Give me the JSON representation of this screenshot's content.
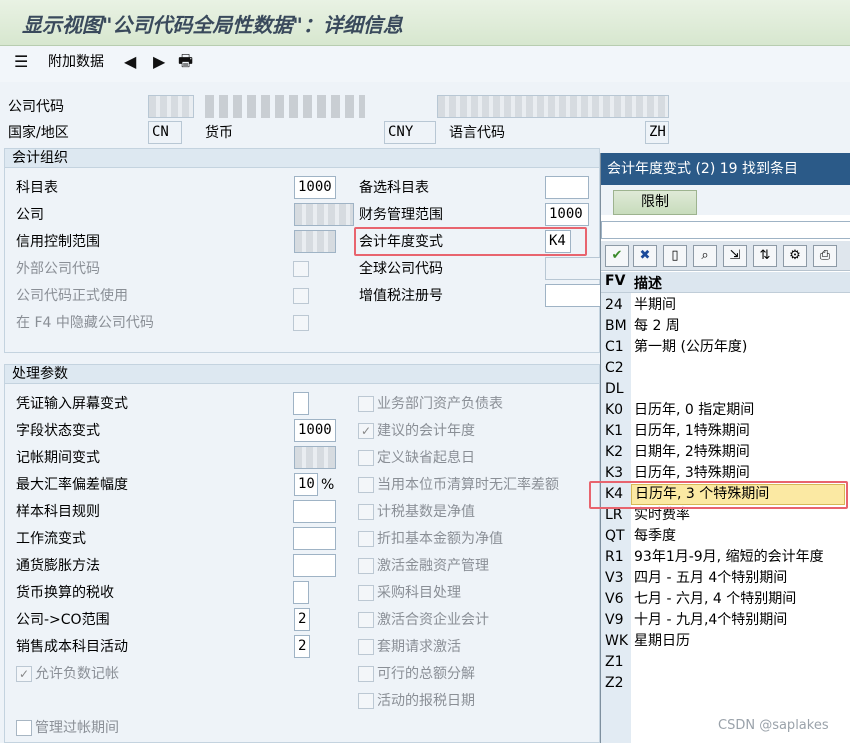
{
  "window": {
    "title": "显示视图\"公司代码全局性数据\"：详细信息"
  },
  "toolbar": {
    "additional_data": "附加数据"
  },
  "header": {
    "company_code_label": "公司代码",
    "country_label": "国家/地区",
    "country_value": "CN",
    "currency_label": "货币",
    "currency_value": "CNY",
    "language_label": "语言代码",
    "language_value": "ZH"
  },
  "accounting_org": {
    "title": "会计组织",
    "chart_of_accounts_label": "科目表",
    "chart_of_accounts_value": "1000",
    "company_label": "公司",
    "credit_control_label": "信用控制范围",
    "external_company_code_label": "外部公司代码",
    "company_code_productive_label": "公司代码正式使用",
    "hide_company_code_f4_label": "在 F4 中隐藏公司代码",
    "alt_chart_label": "备选科目表",
    "fm_area_label": "财务管理范围",
    "fm_area_value": "1000",
    "fiscal_year_variant_label": "会计年度变式",
    "fiscal_year_variant_value": "K4",
    "global_company_code_label": "全球公司代码",
    "vat_registration_label": "增值税注册号"
  },
  "processing": {
    "title": "处理参数",
    "left": [
      {
        "label": "凭证输入屏幕变式",
        "value": ""
      },
      {
        "label": "字段状态变式",
        "value": "1000"
      },
      {
        "label": "记帐期间变式",
        "value": ""
      },
      {
        "label": "最大汇率偏差幅度",
        "value": "10",
        "unit": "%"
      },
      {
        "label": "样本科目规则",
        "value": ""
      },
      {
        "label": "工作流变式",
        "value": ""
      },
      {
        "label": "通货膨胀方法",
        "value": ""
      },
      {
        "label": "货币换算的税收",
        "value": ""
      },
      {
        "label": "公司->CO范围",
        "value": "2"
      },
      {
        "label": "销售成本科目活动",
        "value": "2"
      }
    ],
    "allow_negative_postings": "允许负数记帐",
    "manage_posting_periods": "管理过帐期间",
    "right": [
      {
        "label": "业务部门资产负债表",
        "checked": ""
      },
      {
        "label": "建议的会计年度",
        "checked": "✓"
      },
      {
        "label": "定义缺省起息日",
        "checked": ""
      },
      {
        "label": "当用本位币清算时无汇率差额",
        "checked": ""
      },
      {
        "label": "计税基数是净值",
        "checked": ""
      },
      {
        "label": "折扣基本金额为净值",
        "checked": ""
      },
      {
        "label": "激活金融资产管理",
        "checked": ""
      },
      {
        "label": "采购科目处理",
        "checked": ""
      },
      {
        "label": "激活合资企业会计",
        "checked": ""
      },
      {
        "label": "套期请求激活",
        "checked": ""
      },
      {
        "label": "可行的总额分解",
        "checked": ""
      },
      {
        "label": "活动的报税日期",
        "checked": ""
      }
    ]
  },
  "popup": {
    "title": "会计年度变式 (2)   19 找到条目",
    "tab": "限制",
    "col_fv": "FV",
    "col_desc": "描述",
    "rows": [
      {
        "fv": "24",
        "desc": "半期间"
      },
      {
        "fv": "BM",
        "desc": "每 2 周"
      },
      {
        "fv": "C1",
        "desc": "第一期 (公历年度)"
      },
      {
        "fv": "C2",
        "desc": ""
      },
      {
        "fv": "DL",
        "desc": ""
      },
      {
        "fv": "K0",
        "desc": "日历年, 0 指定期间"
      },
      {
        "fv": "K1",
        "desc": "日历年, 1特殊期间"
      },
      {
        "fv": "K2",
        "desc": "日期年, 2特殊期间"
      },
      {
        "fv": "K3",
        "desc": "日历年, 3特殊期间"
      },
      {
        "fv": "K4",
        "desc": "日历年, 3 个特殊期间"
      },
      {
        "fv": "LR",
        "desc": "实时费率"
      },
      {
        "fv": "QT",
        "desc": "每季度"
      },
      {
        "fv": "R1",
        "desc": "93年1月-9月, 缩短的会计年度"
      },
      {
        "fv": "V3",
        "desc": "四月 - 五月 4个特别期间"
      },
      {
        "fv": "V6",
        "desc": "七月 - 六月, 4 个特别期间"
      },
      {
        "fv": "V9",
        "desc": "十月 - 九月,4个特别期间"
      },
      {
        "fv": "WK",
        "desc": "星期日历"
      },
      {
        "fv": "Z1",
        "desc": ""
      },
      {
        "fv": "Z2",
        "desc": ""
      }
    ]
  },
  "watermark": "CSDN @saplakes"
}
